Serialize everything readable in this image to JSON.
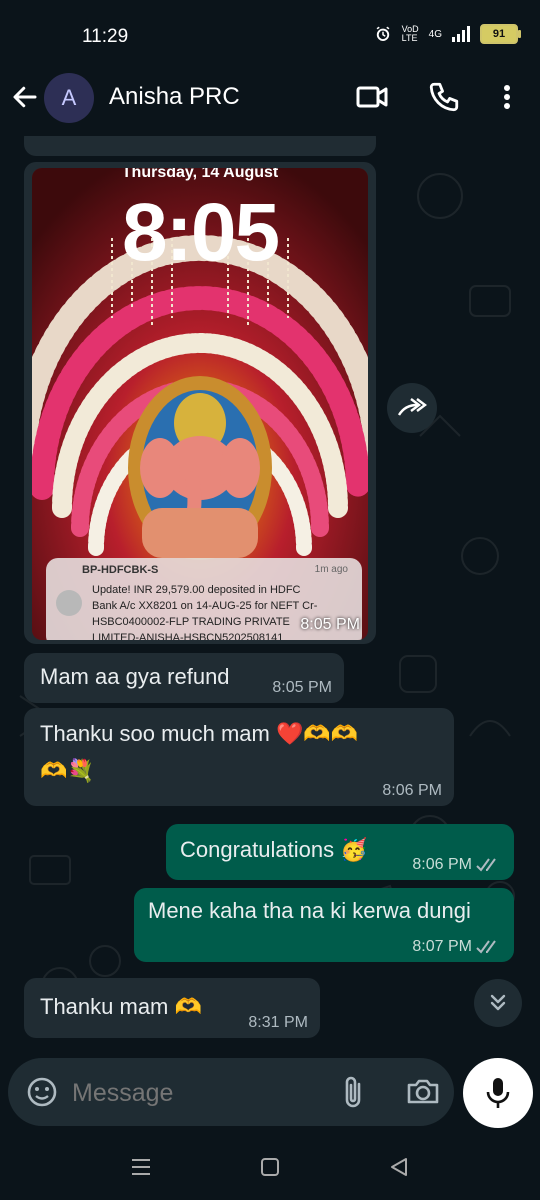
{
  "status_bar": {
    "time": "11:29",
    "battery": "91",
    "network": "4G"
  },
  "header": {
    "avatar_initial": "A",
    "contact_name": "Anisha PRC"
  },
  "image_message": {
    "lock_date": "Thursday, 14 August",
    "lock_time": "8:05",
    "notification": {
      "sender": "BP-HDFCBK-S",
      "age": "1m ago",
      "line1": "Update! INR 29,579.00 deposited in HDFC",
      "line2": "Bank A/c XX8201 on 14-AUG-25 for NEFT Cr-",
      "line3": "HSBC0400002-FLP TRADING PRIVATE",
      "line4": "LIMITED-ANISHA-HSBCN5202508141"
    },
    "time": "8:05 PM"
  },
  "messages": [
    {
      "text": "Mam aa gya refund",
      "time": "8:05 PM"
    },
    {
      "text": "Thanku soo much mam ❤️🫶🫶",
      "text2": "🫶💐",
      "time": "8:06 PM"
    },
    {
      "text": "Congratulations 🥳",
      "time": "8:06 PM"
    },
    {
      "text": "Mene kaha tha na ki kerwa dungi",
      "time": "8:07 PM"
    },
    {
      "text": "Thanku mam 🫶",
      "time": "8:31 PM"
    }
  ],
  "composer": {
    "placeholder": "Message"
  },
  "colors": {
    "incoming": "#202c33",
    "outgoing": "#005c4b",
    "background": "#0b141a"
  }
}
